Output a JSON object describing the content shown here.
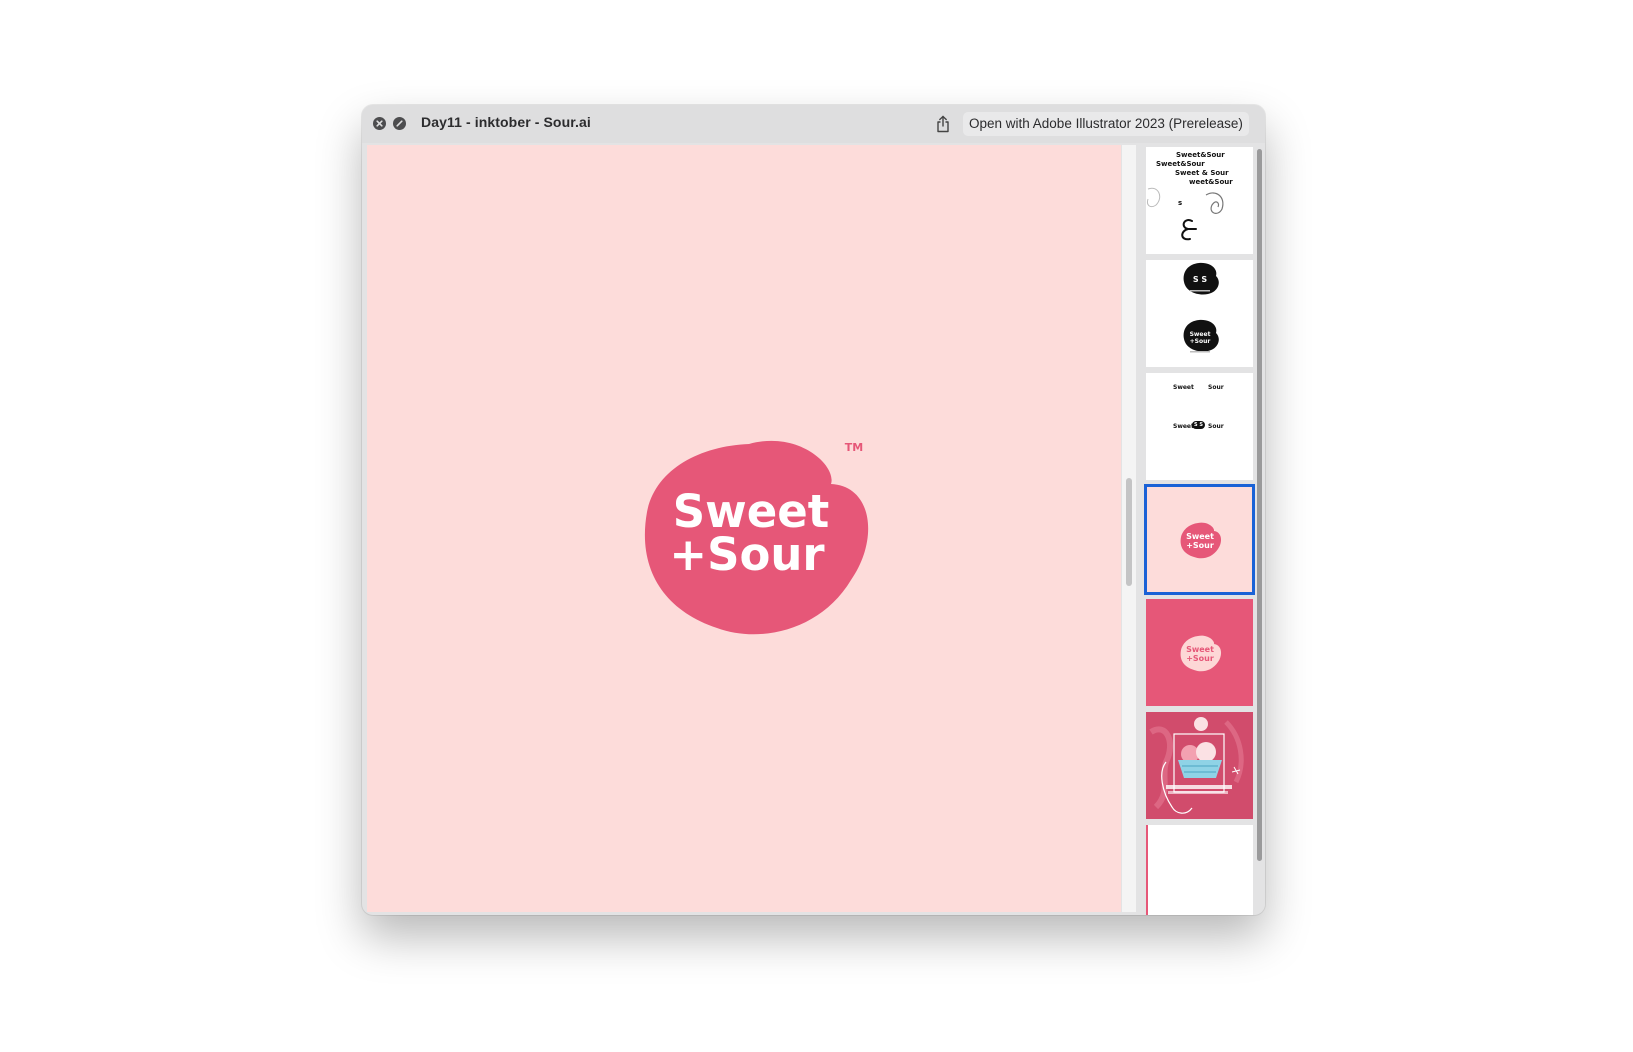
{
  "window": {
    "title": "Day11 - inktober - Sour.ai",
    "open_with_label": "Open with Adobe Illustrator 2023 (Prerelease)"
  },
  "logo": {
    "line1": "Sweet",
    "line2": "+Sour",
    "trademark": "TM"
  },
  "thumbnails": [
    {
      "lines": [
        "Sweet&Sour",
        "Sweet&Sour",
        "Sweet & Sour",
        "weet&Sour"
      ],
      "extra": "s"
    },
    {
      "badge_top": "S S",
      "badge_bottom_1": "Sweet",
      "badge_bottom_2": "+Sour"
    },
    {
      "row1_left": "Sweet",
      "row1_right": "Sour",
      "row2_left": "Sweet",
      "row2_badge": "S S",
      "row2_right": "Sour"
    },
    {
      "line1": "Sweet",
      "line2": "+Sour"
    },
    {
      "line1": "Sweet",
      "line2": "+Sour"
    },
    {},
    {}
  ],
  "colors": {
    "canvas_bg": "#fddcda",
    "brand_pink": "#e65778",
    "selection": "#1a62d6"
  }
}
